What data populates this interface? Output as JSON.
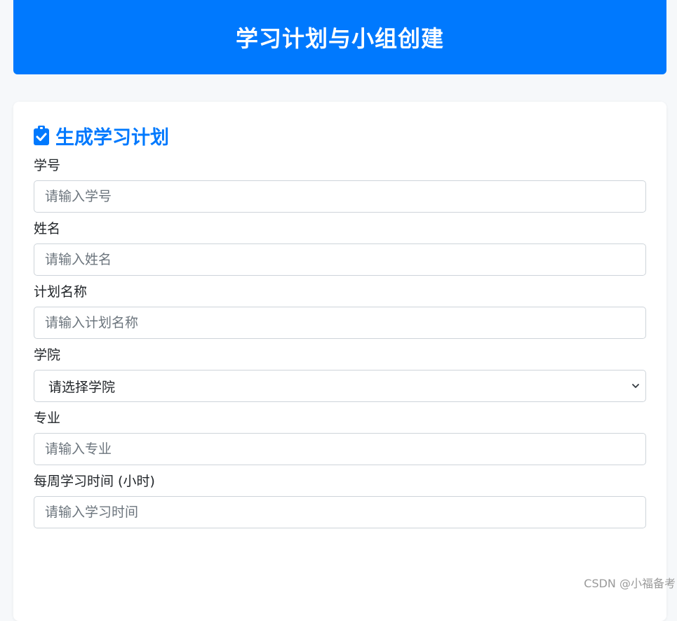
{
  "header": {
    "title": "学习计划与小组创建"
  },
  "section": {
    "title": "生成学习计划",
    "icon": "clipboard-check-icon"
  },
  "form": {
    "student_id": {
      "label": "学号",
      "placeholder": "请输入学号"
    },
    "name": {
      "label": "姓名",
      "placeholder": "请输入姓名"
    },
    "plan_name": {
      "label": "计划名称",
      "placeholder": "请输入计划名称"
    },
    "college": {
      "label": "学院",
      "selected": "请选择学院"
    },
    "major": {
      "label": "专业",
      "placeholder": "请输入专业"
    },
    "weekly_hours": {
      "label": "每周学习时间 (小时)",
      "placeholder": "请输入学习时间"
    }
  },
  "watermark": "CSDN @小福备考",
  "colors": {
    "primary": "#0079fe",
    "background": "#f6f8fa"
  }
}
